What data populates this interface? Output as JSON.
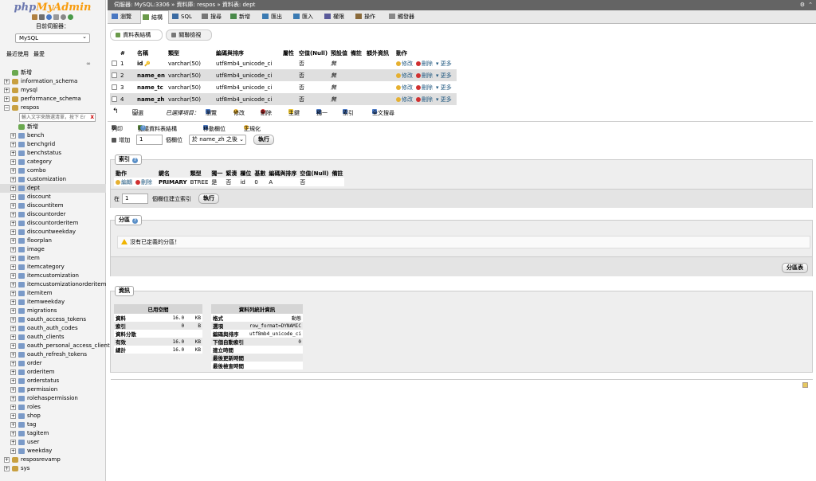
{
  "sidebar": {
    "logo_php": "php",
    "logo_myadmin": "MyAdmin",
    "current_server_label": "目前伺服器：",
    "server_select": "MySQL",
    "recent_label": "最近使用",
    "favorites_label": "最愛",
    "tree": [
      {
        "label": "新增",
        "level": 0,
        "type": "new"
      },
      {
        "label": "information_schema",
        "level": 0,
        "type": "db"
      },
      {
        "label": "mysql",
        "level": 0,
        "type": "db"
      },
      {
        "label": "performance_schema",
        "level": 0,
        "type": "db"
      },
      {
        "label": "respos",
        "level": 0,
        "type": "db-open"
      },
      {
        "label": "輸入文字來篩選清單，按下 Er",
        "level": 1,
        "type": "filter"
      },
      {
        "label": "新增",
        "level": 1,
        "type": "new"
      },
      {
        "label": "bench",
        "level": 1,
        "type": "table"
      },
      {
        "label": "benchgrid",
        "level": 1,
        "type": "table"
      },
      {
        "label": "benchstatus",
        "level": 1,
        "type": "table"
      },
      {
        "label": "category",
        "level": 1,
        "type": "table"
      },
      {
        "label": "combo",
        "level": 1,
        "type": "table"
      },
      {
        "label": "customization",
        "level": 1,
        "type": "table"
      },
      {
        "label": "dept",
        "level": 1,
        "type": "table",
        "selected": true
      },
      {
        "label": "discount",
        "level": 1,
        "type": "table"
      },
      {
        "label": "discountitem",
        "level": 1,
        "type": "table"
      },
      {
        "label": "discountorder",
        "level": 1,
        "type": "table"
      },
      {
        "label": "discountorderitem",
        "level": 1,
        "type": "table"
      },
      {
        "label": "discountweekday",
        "level": 1,
        "type": "table"
      },
      {
        "label": "floorplan",
        "level": 1,
        "type": "table"
      },
      {
        "label": "image",
        "level": 1,
        "type": "table"
      },
      {
        "label": "item",
        "level": 1,
        "type": "table"
      },
      {
        "label": "itemcategory",
        "level": 1,
        "type": "table"
      },
      {
        "label": "itemcustomization",
        "level": 1,
        "type": "table"
      },
      {
        "label": "itemcustomizationorderitem",
        "level": 1,
        "type": "table"
      },
      {
        "label": "itemitem",
        "level": 1,
        "type": "table"
      },
      {
        "label": "itemweekday",
        "level": 1,
        "type": "table"
      },
      {
        "label": "migrations",
        "level": 1,
        "type": "table"
      },
      {
        "label": "oauth_access_tokens",
        "level": 1,
        "type": "table"
      },
      {
        "label": "oauth_auth_codes",
        "level": 1,
        "type": "table"
      },
      {
        "label": "oauth_clients",
        "level": 1,
        "type": "table"
      },
      {
        "label": "oauth_personal_access_clients",
        "level": 1,
        "type": "table"
      },
      {
        "label": "oauth_refresh_tokens",
        "level": 1,
        "type": "table"
      },
      {
        "label": "order",
        "level": 1,
        "type": "table"
      },
      {
        "label": "orderitem",
        "level": 1,
        "type": "table"
      },
      {
        "label": "orderstatus",
        "level": 1,
        "type": "table"
      },
      {
        "label": "permission",
        "level": 1,
        "type": "table"
      },
      {
        "label": "rolehaspermission",
        "level": 1,
        "type": "table"
      },
      {
        "label": "roles",
        "level": 1,
        "type": "table"
      },
      {
        "label": "shop",
        "level": 1,
        "type": "table"
      },
      {
        "label": "tag",
        "level": 1,
        "type": "table"
      },
      {
        "label": "tagitem",
        "level": 1,
        "type": "table"
      },
      {
        "label": "user",
        "level": 1,
        "type": "table"
      },
      {
        "label": "weekday",
        "level": 1,
        "type": "table"
      },
      {
        "label": "resposrevamp",
        "level": 0,
        "type": "db"
      },
      {
        "label": "sys",
        "level": 0,
        "type": "db"
      }
    ]
  },
  "breadcrumb": {
    "server": "伺服器: MySQL:3306",
    "database": "資料庫: respos",
    "table": "資料表: dept"
  },
  "tabs": [
    {
      "label": "瀏覽",
      "active": false,
      "color": "#4a78c2"
    },
    {
      "label": "結構",
      "active": true,
      "color": "#6a9a4a"
    },
    {
      "label": "SQL",
      "active": false,
      "color": "#3a6aa2"
    },
    {
      "label": "搜尋",
      "active": false,
      "color": "#777777"
    },
    {
      "label": "新增",
      "active": false,
      "color": "#4a8a4a"
    },
    {
      "label": "匯出",
      "active": false,
      "color": "#3a7ab2"
    },
    {
      "label": "匯入",
      "active": false,
      "color": "#3a7ab2"
    },
    {
      "label": "權限",
      "active": false,
      "color": "#5a5a9a"
    },
    {
      "label": "操作",
      "active": false,
      "color": "#8a6a3a"
    },
    {
      "label": "觸發器",
      "active": false,
      "color": "#888888"
    }
  ],
  "subtabs": [
    {
      "label": "資料表結構",
      "active": true
    },
    {
      "label": "關聯檢視",
      "active": false
    }
  ],
  "columns_table": {
    "headers": [
      "#",
      "名稱",
      "類型",
      "編碼與排序",
      "屬性",
      "空值(Null)",
      "預設值",
      "備註",
      "額外資訊",
      "動作"
    ],
    "rows": [
      {
        "num": "1",
        "name": "id",
        "key": true,
        "type": "varchar(50)",
        "collation": "utf8mb4_unicode_ci",
        "attr": "",
        "null": "否",
        "default": "無",
        "comment": "",
        "extra": ""
      },
      {
        "num": "2",
        "name": "name_en",
        "key": false,
        "type": "varchar(50)",
        "collation": "utf8mb4_unicode_ci",
        "attr": "",
        "null": "否",
        "default": "無",
        "comment": "",
        "extra": ""
      },
      {
        "num": "3",
        "name": "name_tc",
        "key": false,
        "type": "varchar(50)",
        "collation": "utf8mb4_unicode_ci",
        "attr": "",
        "null": "否",
        "default": "無",
        "comment": "",
        "extra": ""
      },
      {
        "num": "4",
        "name": "name_zh",
        "key": false,
        "type": "varchar(50)",
        "collation": "utf8mb4_unicode_ci",
        "attr": "",
        "null": "否",
        "default": "無",
        "comment": "",
        "extra": ""
      }
    ],
    "actions": {
      "edit": "修改",
      "delete": "刪除",
      "more": "更多"
    }
  },
  "bulk": {
    "check_all": "全選",
    "with_selected": "已選擇項目：",
    "browse": "瀏覽",
    "edit": "修改",
    "delete": "刪除",
    "primary": "主鍵",
    "unique": "獨一",
    "index": "索引",
    "fulltext": "全文搜尋"
  },
  "tools": {
    "print": "列印",
    "propose": "提議資料表結構",
    "move_columns": "移動欄位",
    "normalize": "正規化"
  },
  "add_columns": {
    "label": "增加",
    "count": "1",
    "unit": "個欄位",
    "position": "於 name_zh 之後",
    "go": "執行"
  },
  "indexes": {
    "legend": "索引",
    "headers": [
      "動作",
      "鍵名",
      "類型",
      "獨一",
      "緊湊",
      "欄位",
      "基數",
      "編碼與排序",
      "空值(Null)",
      "備註"
    ],
    "rows": [
      {
        "edit": "編輯",
        "delete": "刪除",
        "keyname": "PRIMARY",
        "type": "BTREE",
        "unique": "是",
        "packed": "否",
        "column": "id",
        "cardinality": "0",
        "collation": "A",
        "null": "否",
        "comment": ""
      }
    ],
    "create_prefix": "在",
    "create_count": "1",
    "create_suffix": "個欄位建立索引",
    "go": "執行"
  },
  "partitions": {
    "legend": "分區",
    "notice": "沒有已定義的分區！",
    "button": "分區表"
  },
  "info": {
    "legend": "資訊",
    "space": {
      "title": "已用空間",
      "rows": [
        {
          "k": "資料",
          "v": "16.0",
          "u": "KB"
        },
        {
          "k": "索引",
          "v": "0",
          "u": "B"
        },
        {
          "k": "資料分散",
          "v": "",
          "u": ""
        },
        {
          "k": "有效",
          "v": "16.0",
          "u": "KB"
        },
        {
          "k": "總計",
          "v": "16.0",
          "u": "KB"
        }
      ]
    },
    "stats": {
      "title": "資料列統計資訊",
      "rows": [
        {
          "k": "格式",
          "v": "動態"
        },
        {
          "k": "選項",
          "v": "row_format=DYNAMIC"
        },
        {
          "k": "編碼與排序",
          "v": "utf8mb4_unicode_ci"
        },
        {
          "k": "下個自動索引",
          "v": "0"
        },
        {
          "k": "建立時間",
          "v": ""
        },
        {
          "k": "最後更新時間",
          "v": ""
        },
        {
          "k": "最後檢查時間",
          "v": ""
        }
      ]
    }
  }
}
